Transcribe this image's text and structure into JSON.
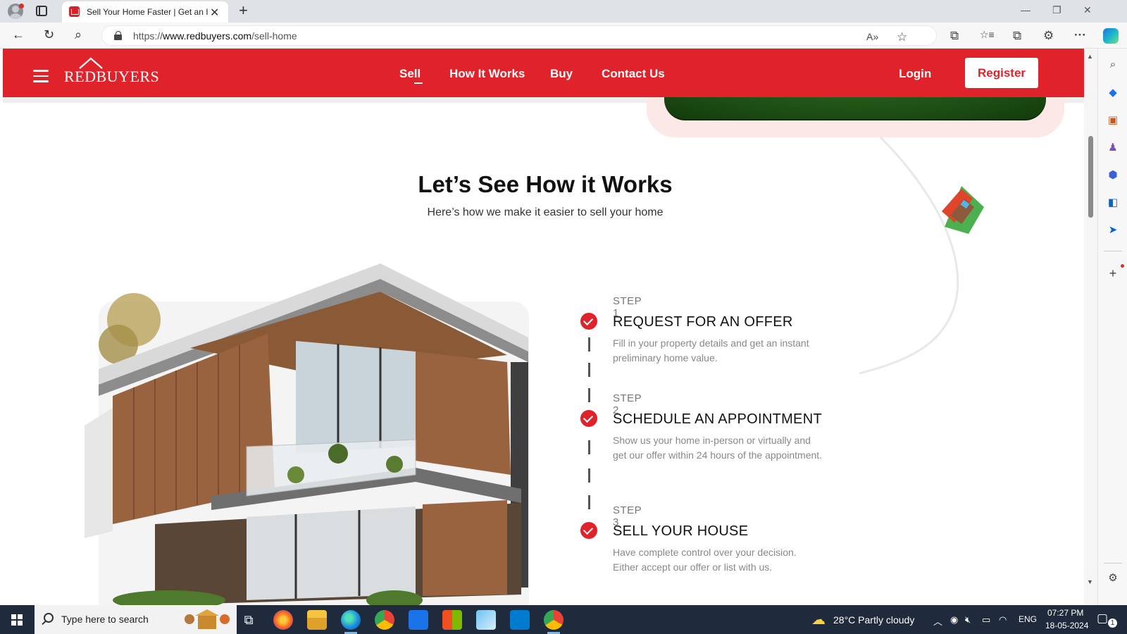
{
  "browser": {
    "tab_title": "Sell Your Home Faster | Get an Instant Offer",
    "tab_close": "✕",
    "new_tab": "+",
    "url_prefix": "https://",
    "url_host": "www.redbuyers.com",
    "url_path": "/sell-home",
    "window_controls": {
      "minimize": "—",
      "restore": "❐",
      "close": "✕"
    },
    "nav": {
      "back": "←",
      "refresh": "↻",
      "search": "⌕"
    },
    "address_icons": {
      "read_aloud": "A»",
      "favorite": "☆",
      "split": "⧉",
      "favorites": "☆≡",
      "collections": "⧉",
      "extensions": "⚙",
      "more": "···"
    }
  },
  "site": {
    "brand": "REDBUYERS",
    "brand_color": "#e0232b",
    "nav": [
      {
        "label": "Sell",
        "active": true
      },
      {
        "label": "How It Works",
        "active": false
      },
      {
        "label": "Buy",
        "active": false
      },
      {
        "label": "Contact Us",
        "active": false
      }
    ],
    "login_label": "Login",
    "register_label": "Register"
  },
  "section": {
    "title": "Let’s See How it Works",
    "subtitle": "Here’s how we make it easier to sell your home"
  },
  "steps": [
    {
      "label": "STEP 1",
      "title": "REQUEST FOR AN OFFER",
      "desc": "Fill in your property details and get an instant preliminary home value."
    },
    {
      "label": "STEP 2",
      "title": "SCHEDULE AN APPOINTMENT",
      "desc": "Show us your home in-person or virtually and get our offer within 24 hours of the appointment."
    },
    {
      "label": "STEP 3",
      "title": "SELL YOUR HOUSE",
      "desc": "Have complete control over your decision. Either accept our offer or list with us."
    }
  ],
  "taskbar": {
    "search_placeholder": "Type here to search",
    "weather": "28°C  Partly cloudy",
    "language": "ENG",
    "time": "07:27 PM",
    "date": "18-05-2024",
    "notification_count": "1"
  }
}
